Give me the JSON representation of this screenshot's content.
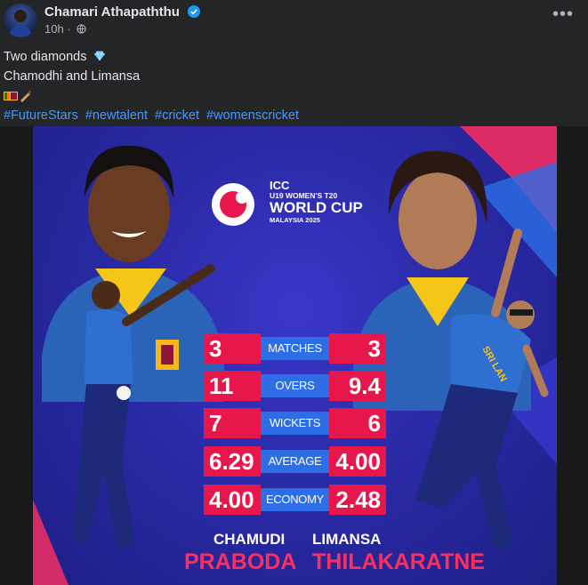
{
  "post": {
    "author": "Chamari Athapaththu",
    "time": "10h",
    "separator": "·",
    "more_label": "•••",
    "lines": [
      "Two diamonds",
      "Chamodhi and Limansa"
    ],
    "hashtags": [
      "#FutureStars",
      "#newtalent",
      "#cricket",
      "#womenscricket"
    ]
  },
  "poster": {
    "logo": {
      "line1": "ICC",
      "line2": "U19 WOMEN'S T20",
      "line3": "WORLD CUP",
      "line4": "MALAYSIA 2025"
    },
    "stats": [
      {
        "label": "MATCHES",
        "left": "3",
        "right": "3"
      },
      {
        "label": "OVERS",
        "left": "11",
        "right": "9.4"
      },
      {
        "label": "WICKETS",
        "left": "7",
        "right": "6"
      },
      {
        "label": "AVERAGE",
        "left": "6.29",
        "right": "4.00"
      },
      {
        "label": "ECONOMY",
        "left": "4.00",
        "right": "2.48"
      }
    ],
    "left_player": {
      "first": "CHAMUDI",
      "last": "PRABODA"
    },
    "right_player": {
      "first": "LIMANSA",
      "last": "THILAKARATNE"
    },
    "jersey_text": "SRI LAN"
  },
  "colors": {
    "accent_red": "#e8174b",
    "label_blue": "#2d6ee6",
    "link_blue": "#4599ff",
    "verified_blue": "#1d9bf0"
  }
}
